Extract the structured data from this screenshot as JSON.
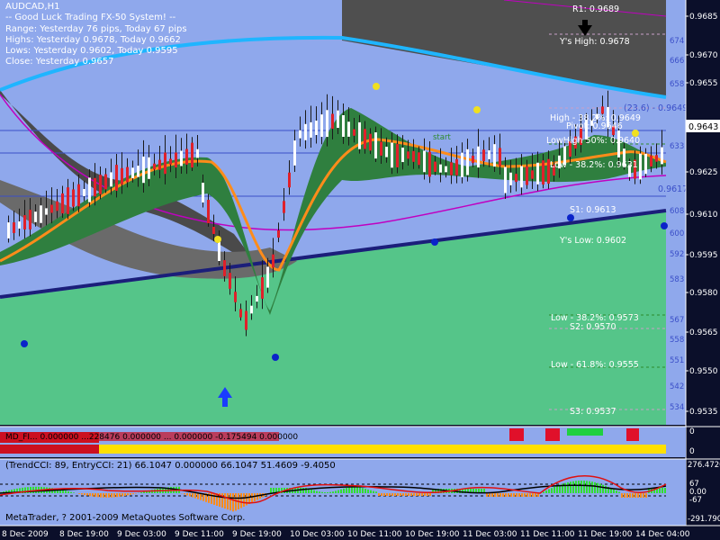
{
  "window": {
    "symbol_tf": "AUDCAD,H1",
    "system_title": "-- Good Luck Trading FX-50 System! --"
  },
  "info": {
    "range": "Range: Yesterday 76 pips, Today 67 pips",
    "highs": "Highs: Yesterday 0.9678, Today 0.9662",
    "lows": "Lows:  Yesterday 0.9602, Today 0.9595",
    "close": "Close: Yesterday 0.9657"
  },
  "price_axis": {
    "ticks": [
      "0.9685",
      "0.9670",
      "0.9655",
      "0.9640",
      "0.9625",
      "0.9610",
      "0.9595",
      "0.9580",
      "0.9565",
      "0.9550",
      "0.9535"
    ],
    "current_price": "0.9643",
    "pip_labels": [
      "674",
      "666",
      "658",
      "633",
      "608",
      "600",
      "592",
      "583",
      "567",
      "558",
      "551",
      "542",
      "534"
    ]
  },
  "levels": {
    "r1": "R1: 0.9689",
    "ys_high": "Y's High: 0.9678",
    "fib_236": "(23.6) - 0.9649",
    "high_382": "High - 38.2%: 0.9649",
    "pivot": "Pivot: 0.9646",
    "lowhigh_50": "LowHigh 50%: 0.9640",
    "low_382": "Low - 38.2%: 0.9631",
    "val_9617": "0.9617",
    "s1": "S1: 0.9613",
    "ys_low": "Y's Low: 0.9602",
    "low_382b": "Low - 38.2%: 0.9573",
    "s2": "S2: 0.9570",
    "low_618": "Low - 61.8%: 0.9555",
    "s3": "S3: 0.9537",
    "start_marker": "start"
  },
  "indicator1": {
    "labels_text": "MD_FI... 0.000000   ...228476 0.000000   ... 0.000000 -0.175494 0.000000",
    "axis_top": "0",
    "axis_bottom": "0"
  },
  "cci": {
    "label": "(TrendCCI: 89, EntryCCI: 21)  66.1047 0.000000 66.1047 51.4609 -9.4050",
    "axis": [
      "276.4726",
      "67",
      "0.00",
      "-67",
      "-291.7904"
    ]
  },
  "footer": {
    "copyright": "MetaTrader, ? 2001-2009 MetaQuotes Software Corp."
  },
  "time_axis": {
    "labels": [
      "8 Dec 2009",
      "8 Dec 19:00",
      "9 Dec 03:00",
      "9 Dec 11:00",
      "9 Dec 19:00",
      "10 Dec 03:00",
      "10 Dec 11:00",
      "10 Dec 19:00",
      "11 Dec 03:00",
      "11 Dec 11:00",
      "11 Dec 19:00",
      "14 Dec 04:00"
    ]
  },
  "colors": {
    "chart_bg": "#8fa8ec",
    "price_bg": "#0b0f2a",
    "bull_candle": "#ffffff",
    "bear_candle": "#e0202a",
    "green_area": "#55c589",
    "gray_band": "#4a4a4a",
    "orange_ma": "#ff8c1a",
    "cyan_line": "#1fb5ff",
    "navy_trend": "#1b1e7a"
  },
  "icons": {
    "down_arrow": "down-arrow-icon",
    "up_arrow": "up-arrow-icon"
  }
}
